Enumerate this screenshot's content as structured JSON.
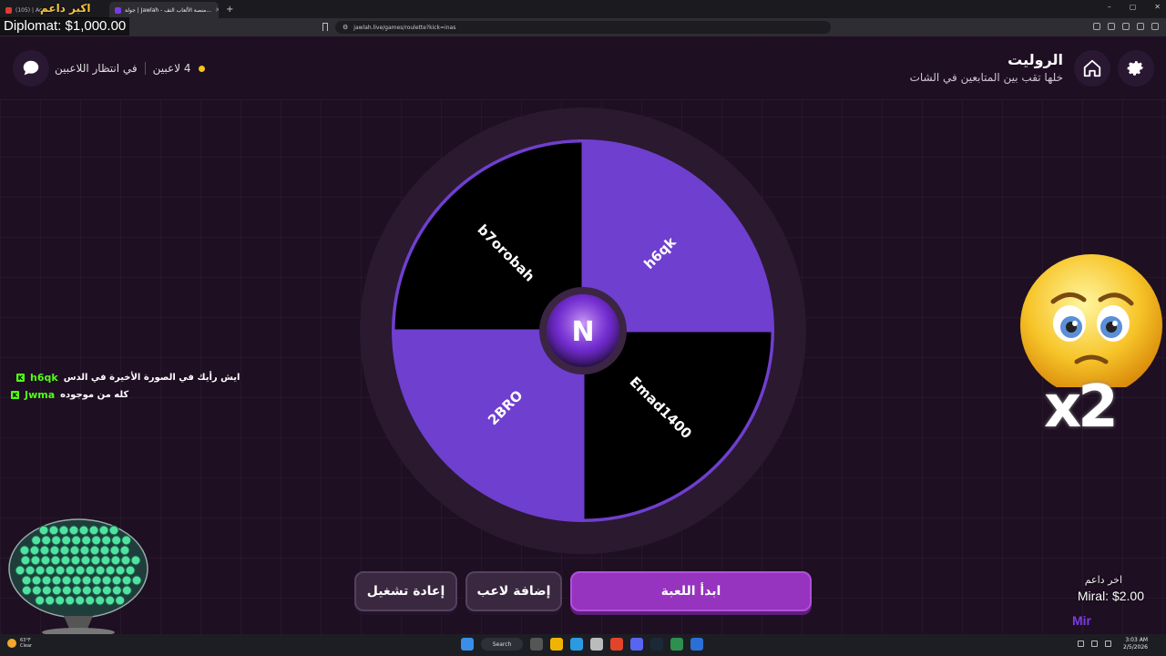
{
  "browser": {
    "tabs": [
      {
        "title": "(105) | Aca..."
      },
      {
        "title": "جولة | Jawlah - منصة الألعاب التف..."
      }
    ],
    "url": "jawlah.live/games/roulette?kick=inas"
  },
  "stream_overlay": {
    "top_donor_name": "اكبر داعم",
    "top_donor_line": "Diplomat: $1,000.00",
    "last_donor_title": "اخر داعم",
    "last_donor_line": "Miral: $2.00",
    "last_donor_logo": "Mir",
    "multiplier": "x2"
  },
  "header": {
    "title": "الروليت",
    "subtitle": "خلها تقب بين المتابعين في الشات",
    "status_text": "في انتظار اللاعبين",
    "players_count": "4 لاعبين"
  },
  "wheel": {
    "segments": [
      {
        "name": "h6qk",
        "color": "#6f3fcf"
      },
      {
        "name": "Emad1400",
        "color": "#000000"
      },
      {
        "name": "2BRO",
        "color": "#6f3fcf"
      },
      {
        "name": "b7orobah",
        "color": "#000000"
      }
    ],
    "center_logo": "N"
  },
  "chat": [
    {
      "user": "h6qk",
      "message": "ايش رأيك في الصورة الأخيرة في الدس",
      "badge": "K"
    },
    {
      "user": "Jwma",
      "message": "كله من موجوده",
      "badge": "K"
    }
  ],
  "buttons": {
    "start": "ابدأ اللعبة",
    "add_player": "إضافة لاعب",
    "restart": "إعادة تشغيل"
  },
  "taskbar": {
    "weather_temp": "63°F",
    "weather_desc": "Clear",
    "search_label": "Search",
    "time": "3:03 AM",
    "date": "2/5/2026"
  },
  "colors": {
    "accent": "#9634bf",
    "wheel_purple": "#6f3fcf",
    "kick_green": "#53fc18"
  }
}
